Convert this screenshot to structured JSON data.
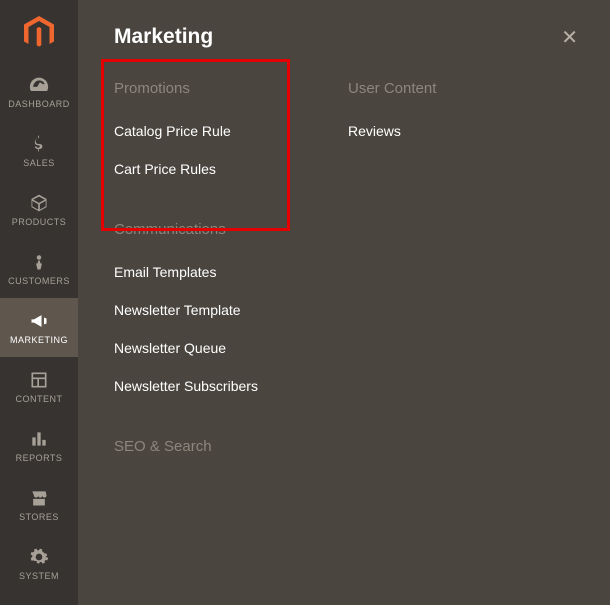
{
  "panel": {
    "title": "Marketing"
  },
  "sidebar": {
    "items": [
      {
        "label": "DASHBOARD"
      },
      {
        "label": "SALES"
      },
      {
        "label": "PRODUCTS"
      },
      {
        "label": "CUSTOMERS"
      },
      {
        "label": "MARKETING"
      },
      {
        "label": "CONTENT"
      },
      {
        "label": "REPORTS"
      },
      {
        "label": "STORES"
      },
      {
        "label": "SYSTEM"
      }
    ]
  },
  "sections": {
    "promotions": {
      "title": "Promotions",
      "links": [
        "Catalog Price Rule",
        "Cart Price Rules"
      ]
    },
    "user_content": {
      "title": "User Content",
      "links": [
        "Reviews"
      ]
    },
    "communications": {
      "title": "Communications",
      "links": [
        "Email Templates",
        "Newsletter Template",
        "Newsletter Queue",
        "Newsletter Subscribers"
      ]
    },
    "seo": {
      "title": "SEO & Search"
    }
  }
}
